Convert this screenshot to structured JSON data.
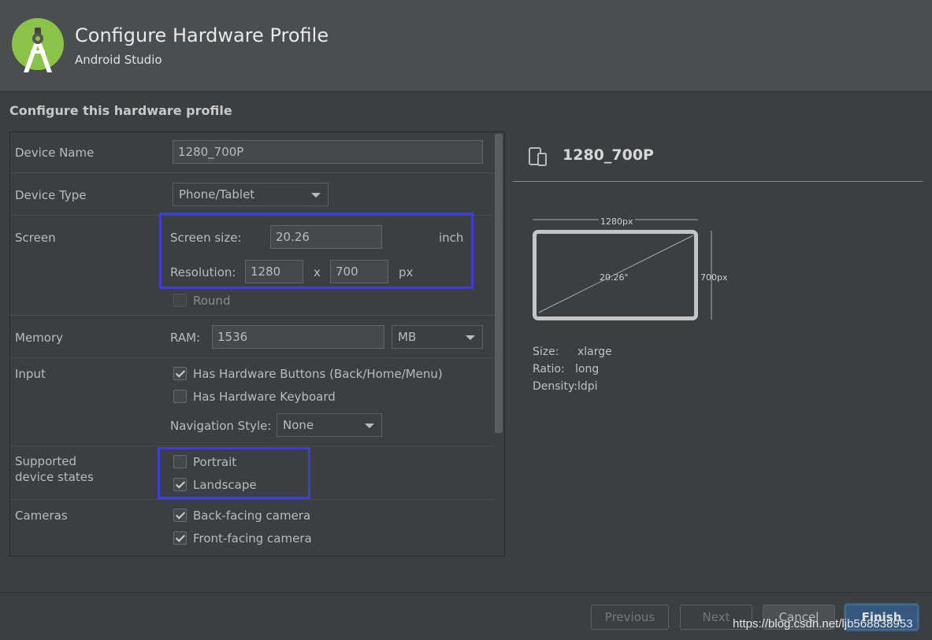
{
  "header": {
    "title": "Configure Hardware Profile",
    "subtitle": "Android Studio"
  },
  "section_title": "Configure this hardware profile",
  "form": {
    "device_name": {
      "label": "Device Name",
      "value": "1280_700P"
    },
    "device_type": {
      "label": "Device Type",
      "value": "Phone/Tablet"
    },
    "screen": {
      "label": "Screen",
      "size_label": "Screen size:",
      "size_value": "20.26",
      "size_unit": "inch",
      "resolution_label": "Resolution:",
      "res_width": "1280",
      "res_x": "x",
      "res_height": "700",
      "res_unit": "px",
      "round_label": "Round"
    },
    "memory": {
      "label": "Memory",
      "ram_label": "RAM:",
      "ram_value": "1536",
      "ram_unit": "MB"
    },
    "input": {
      "label": "Input",
      "hw_buttons": "Has Hardware Buttons (Back/Home/Menu)",
      "hw_keyboard": "Has Hardware Keyboard",
      "nav_style_label": "Navigation Style:",
      "nav_style_value": "None"
    },
    "states": {
      "label_line1": "Supported",
      "label_line2": "device states",
      "portrait": "Portrait",
      "landscape": "Landscape"
    },
    "cameras": {
      "label": "Cameras",
      "back": "Back-facing camera",
      "front": "Front-facing camera"
    }
  },
  "preview": {
    "name": "1280_700P",
    "width_label": "1280px",
    "height_label": "700px",
    "diagonal_label": "20.26\"",
    "size_key": "Size:",
    "size_val": "xlarge",
    "ratio_key": "Ratio:",
    "ratio_val": "long",
    "density_key": "Density:",
    "density_val": "ldpi"
  },
  "buttons": {
    "previous": "Previous",
    "next": "Next",
    "cancel": "Cancel",
    "finish": "Finish"
  },
  "watermark": "https://blog.csdn.net/ljb568838953",
  "colors": {
    "highlight_box": "#3b3fd6",
    "logo_green": "#8bc34a"
  }
}
